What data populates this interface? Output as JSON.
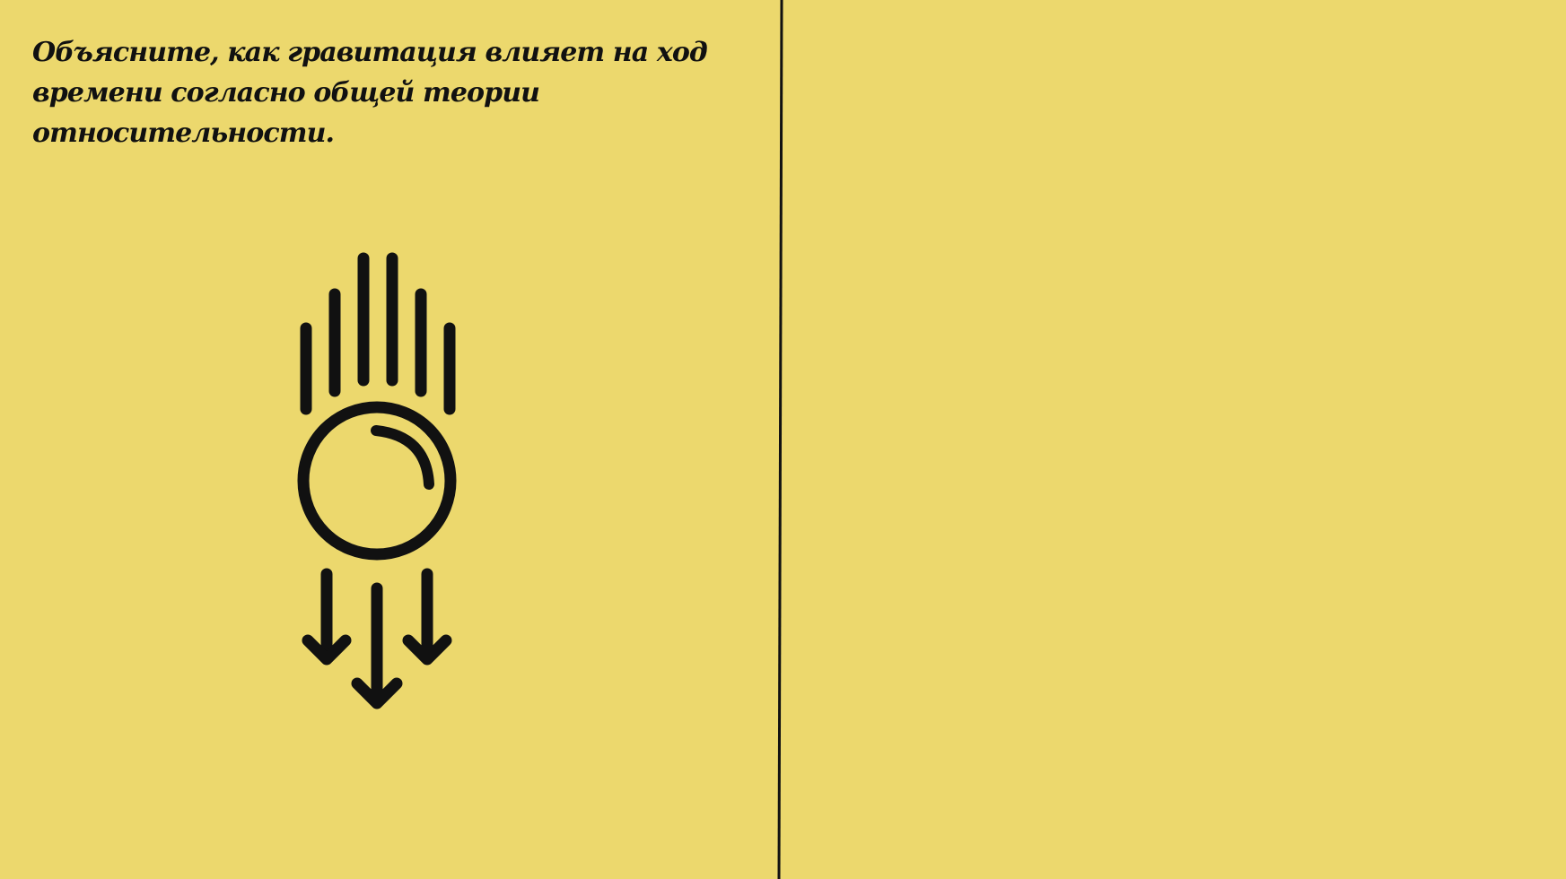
{
  "canvas": {
    "background_color": "#ECD86D",
    "ink_color": "#111111"
  },
  "left_panel": {
    "question": "Объясните, как гравитация влияет на ход времени согласно общей теории относительности.",
    "illustration": {
      "icon_name": "falling-ball-icon"
    }
  },
  "right_panel": {
    "answer": ""
  }
}
